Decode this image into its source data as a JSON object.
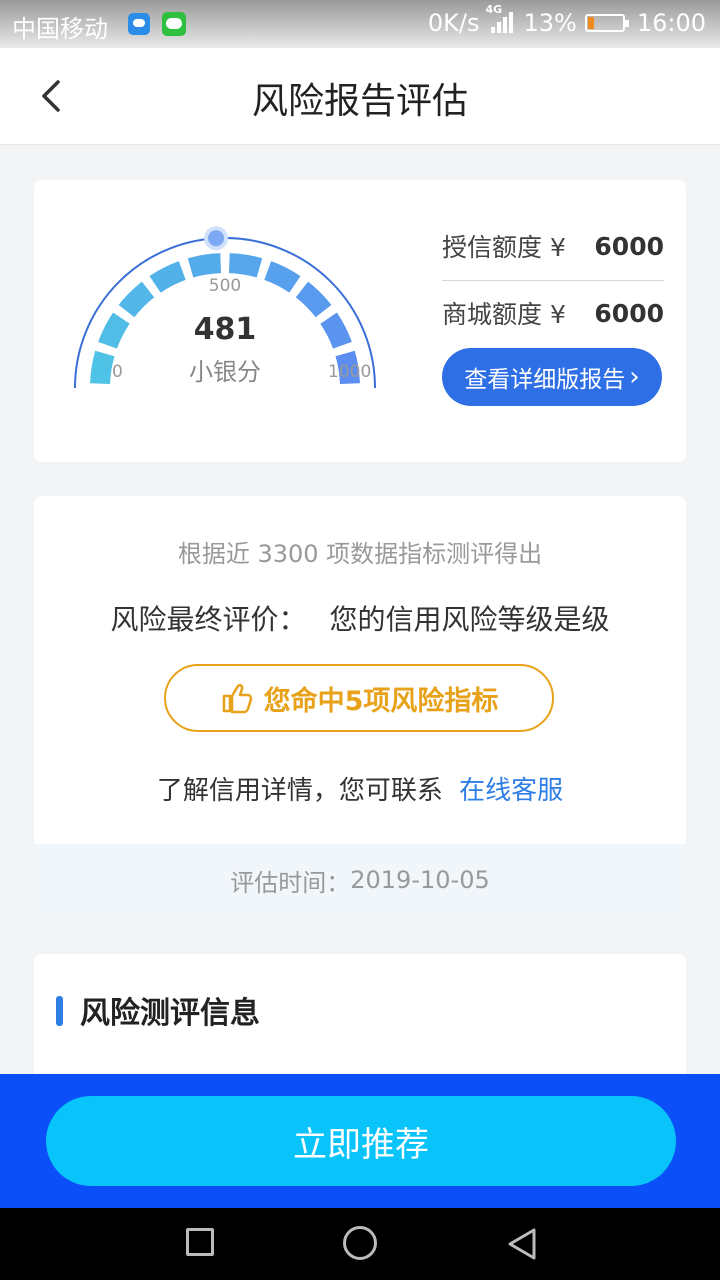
{
  "status_bar": {
    "carrier": "中国移动",
    "speed": "0K/s",
    "network": "4G",
    "battery_percent": "13%",
    "time": "16:00",
    "icons": [
      "message-icon",
      "wechat-icon",
      "signal-icon",
      "battery-icon"
    ]
  },
  "header": {
    "title": "风险报告评估",
    "back_icon": "chevron-left-icon"
  },
  "score_card": {
    "score": "481",
    "score_label": "小银分",
    "gauge_min": "0",
    "gauge_mid": "500",
    "gauge_max": "1000",
    "score_value": 481,
    "gauge_range": [
      0,
      1000
    ],
    "credit_limit_label": "授信额度 ¥",
    "credit_limit_value": "6000",
    "mall_limit_label": "商城额度 ¥",
    "mall_limit_value": "6000",
    "report_button": "查看详细版报告",
    "report_button_chevron": "›"
  },
  "evaluation": {
    "basis": "根据近 3300 项数据指标测评得出",
    "final_label": "风险最终评价：",
    "final_text": "您的信用风险等级是级",
    "hit_text": "您命中5项风险指标",
    "hit_icon": "thumbs-up-icon",
    "contact_text": "了解信用详情，您可联系",
    "contact_link": "在线客服",
    "time_label": "评估时间：",
    "time_value": "2019-10-05"
  },
  "info_section": {
    "title": "风险测评信息"
  },
  "action": {
    "button_label": "立即推荐"
  },
  "colors": {
    "primary_blue": "#2f6fe6",
    "action_bar": "#0a4ff7",
    "action_button": "#09c4fa",
    "warning_orange": "#e8a21a",
    "gauge_light": "#4fc3e6",
    "gauge_dark": "#5b8ef0"
  }
}
